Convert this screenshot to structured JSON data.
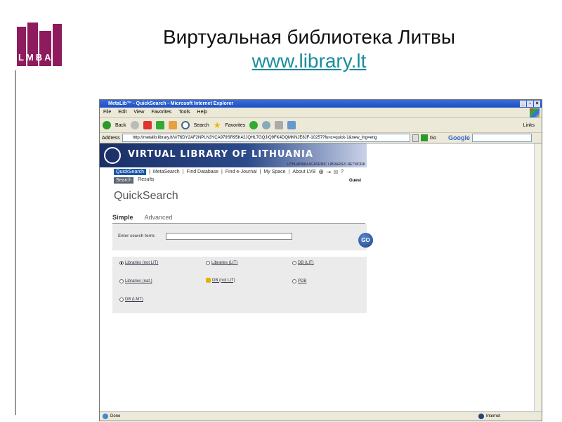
{
  "slide": {
    "title": "Виртуальная библиотека Литвы",
    "link": "www.library.lt",
    "logo_text": "LMBA"
  },
  "browser": {
    "title": "MetaLib™ - QuickSearch - Microsoft Internet Explorer",
    "controls": [
      "_",
      "▫",
      "×"
    ],
    "menu": [
      "File",
      "Edit",
      "View",
      "Favorites",
      "Tools",
      "Help"
    ],
    "toolbar": {
      "back": "Back",
      "search": "Search",
      "favorites": "Favorites",
      "links": "Links"
    },
    "address_label": "Address",
    "url": "http://metalib.library.lt/V/76DY2AF2NPLN3YCA979SR95K42JQHL7GQJIQ9FK4DQMKNJE8JF-10257?func=quick-1&new_lng=eng",
    "go": "Go",
    "google": "Google",
    "status": "Done",
    "zone": "Internet"
  },
  "page": {
    "banner": "VIRTUAL LIBRARY OF LITHUANIA",
    "banner_sub": "LITHUANIAN ACADEMIC LIBRARIES NETWORK",
    "nav": [
      "QuickSearch",
      "MetaSearch",
      "Find Database",
      "Find e-Journal",
      "My Space",
      "About LVB"
    ],
    "sub": [
      "Search",
      "Results"
    ],
    "guest": "Guest",
    "heading": "QuickSearch",
    "tabs": [
      "Simple",
      "Advanced"
    ],
    "search_label": "Enter search term:",
    "search_value": "",
    "go": "GO",
    "options": [
      "Libraries (not LIT)",
      "Libraries (LIT)",
      "DB (LIT)",
      "Libraries (nat.)",
      "DB (not LIT)",
      "PDB",
      "DB (LMT)"
    ]
  }
}
